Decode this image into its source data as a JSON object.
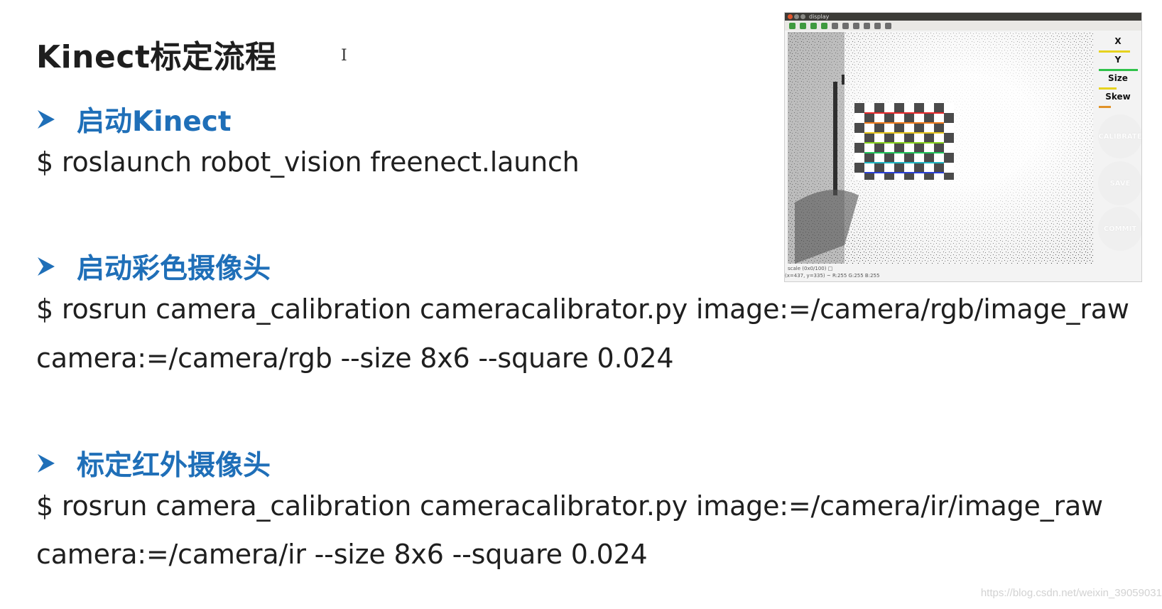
{
  "slide": {
    "title": "Kinect标定流程",
    "cursor_glyph": "I",
    "sections": [
      {
        "heading": "启动Kinect",
        "commands": [
          "$ roslaunch robot_vision freenect.launch"
        ]
      },
      {
        "heading": "启动彩色摄像头",
        "commands": [
          "$ rosrun camera_calibration cameracalibrator.py image:=/camera/rgb/image_raw",
          "camera:=/camera/rgb --size 8x6 --square 0.024"
        ]
      },
      {
        "heading": "标定红外摄像头",
        "commands": [
          "$ rosrun camera_calibration cameracalibrator.py image:=/camera/ir/image_raw",
          "camera:=/camera/ir --size 8x6 --square 0.024"
        ]
      }
    ]
  },
  "calibrator_window": {
    "window_title": "display",
    "metrics": [
      {
        "label": "X",
        "color": "#e6d21e",
        "level": 0.8
      },
      {
        "label": "Y",
        "color": "#2fc24a",
        "level": 1.0
      },
      {
        "label": "Size",
        "color": "#e6d21e",
        "level": 0.45
      },
      {
        "label": "Skew",
        "color": "#e0932a",
        "level": 0.3
      }
    ],
    "buttons": [
      "CALIBRATE",
      "SAVE",
      "COMMIT"
    ],
    "status_line_1": "scale  (0x0/100) □",
    "status_line_2": "(x=437, y=335) ~ R:255 G:255 B:255"
  },
  "watermark": "https://blog.csdn.net/weixin_39059031",
  "colors": {
    "heading_blue": "#1f6fb8",
    "bullet_blue": "#1f6fb8",
    "text": "#1f1f1f"
  }
}
